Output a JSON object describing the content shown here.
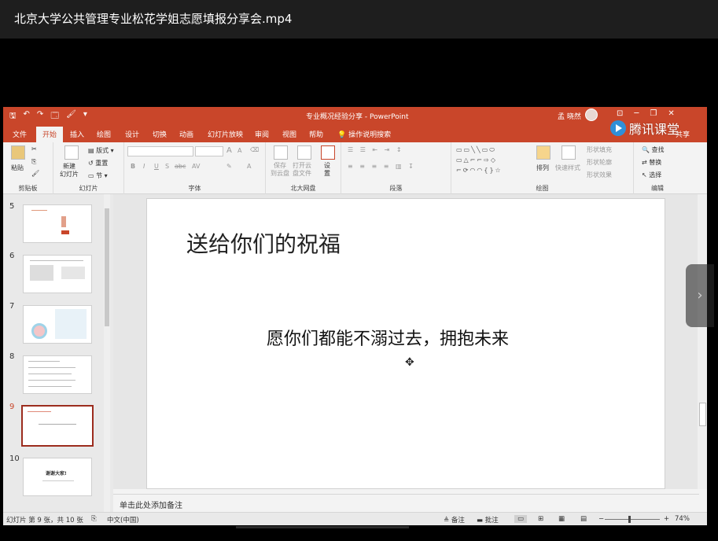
{
  "player": {
    "title": "北京大学公共管理专业松花学姐志愿填报分享会.mp4"
  },
  "window": {
    "doc_title": "专业概况经验分享 - PowerPoint",
    "user": "孟 晓然",
    "qat": [
      "🖫",
      "↶",
      "↷",
      "🗔",
      "🖌",
      "▾"
    ],
    "winbtns": [
      "⊡",
      "─",
      "❐",
      "✕"
    ]
  },
  "watermark": {
    "text": "腾讯课堂"
  },
  "tabs": {
    "items": [
      "文件",
      "开始",
      "插入",
      "绘图",
      "设计",
      "切换",
      "动画",
      "幻灯片放映",
      "审阅",
      "视图",
      "帮助"
    ],
    "active": "开始",
    "tell_me": "操作说明搜索",
    "share": "共享"
  },
  "ribbon": {
    "clipboard": {
      "name": "剪贴板",
      "paste": "粘贴"
    },
    "slides": {
      "name": "幻灯片",
      "new_slide": "新建\n幻灯片",
      "layout": "版式",
      "reset": "重置",
      "section": "节"
    },
    "font": {
      "name": "字体",
      "bold": "B",
      "italic": "I",
      "underline": "U",
      "strike": "S",
      "spacing": "abc",
      "case": "AV",
      "grow": "A",
      "shrink": "A"
    },
    "cloud": {
      "name": "北大网盘",
      "save": "保存\n到云盘",
      "open": "打开云\n盘文件",
      "settings": "设\n置"
    },
    "paragraph": {
      "name": "段落"
    },
    "drawing": {
      "name": "绘图",
      "arrange": "排列",
      "quick_styles": "快速样式",
      "fill": "形状填充",
      "outline": "形状轮廓",
      "effects": "形状效果"
    },
    "editing": {
      "name": "编辑",
      "find": "查找",
      "replace": "替换",
      "select": "选择"
    }
  },
  "thumbnails": [
    {
      "num": "5"
    },
    {
      "num": "6"
    },
    {
      "num": "7"
    },
    {
      "num": "8"
    },
    {
      "num": "9",
      "active": true,
      "title": "送给你们的祝福",
      "body": "愿你们都能不溺过去，拥抱未来"
    },
    {
      "num": "10",
      "title": "谢谢大家!"
    }
  ],
  "slide": {
    "title": "送给你们的祝福",
    "body": "愿你们都能不溺过去，拥抱未来"
  },
  "notes": {
    "placeholder": "单击此处添加备注"
  },
  "status": {
    "slide_info": "幻灯片 第 9 张，共 10 张",
    "language": "中文(中国)",
    "notes_btn": "备注",
    "comments_btn": "批注",
    "zoom": "74%"
  },
  "colors": {
    "accent": "#c9462a",
    "active_thumb": "#9c2c1e"
  }
}
